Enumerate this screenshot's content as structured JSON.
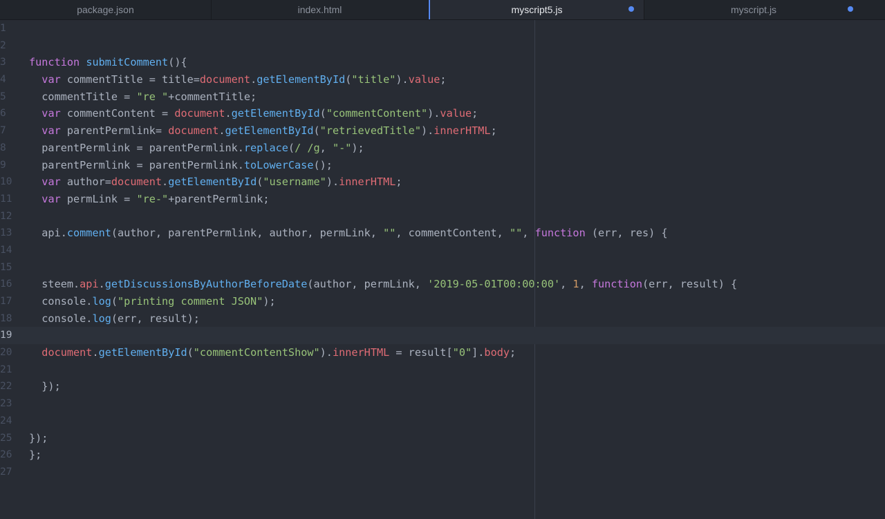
{
  "tabs": [
    {
      "label": "package.json",
      "active": false,
      "modified": false
    },
    {
      "label": "index.html",
      "active": false,
      "modified": false
    },
    {
      "label": "myscript5.js",
      "active": true,
      "modified": true
    },
    {
      "label": "myscript.js",
      "active": false,
      "modified": true
    }
  ],
  "editor": {
    "cursor_line": 19,
    "lines": [
      {
        "n": "1",
        "t": []
      },
      {
        "n": "2",
        "t": []
      },
      {
        "n": "3",
        "t": [
          [
            "kw",
            "function"
          ],
          [
            "pl",
            " "
          ],
          [
            "fn",
            "submitComment"
          ],
          [
            "pl",
            "(){"
          ]
        ]
      },
      {
        "n": "4",
        "t": [
          [
            "pl",
            "  "
          ],
          [
            "kw",
            "var"
          ],
          [
            "pl",
            " commentTitle = title="
          ],
          [
            "prop",
            "document"
          ],
          [
            "pl",
            "."
          ],
          [
            "fn",
            "getElementById"
          ],
          [
            "pl",
            "("
          ],
          [
            "str",
            "\"title\""
          ],
          [
            "pl",
            ")."
          ],
          [
            "prop",
            "value"
          ],
          [
            "pl",
            ";"
          ]
        ]
      },
      {
        "n": "5",
        "t": [
          [
            "pl",
            "  commentTitle = "
          ],
          [
            "str",
            "\"re \""
          ],
          [
            "pl",
            "+commentTitle;"
          ]
        ]
      },
      {
        "n": "6",
        "t": [
          [
            "pl",
            "  "
          ],
          [
            "kw",
            "var"
          ],
          [
            "pl",
            " commentContent = "
          ],
          [
            "prop",
            "document"
          ],
          [
            "pl",
            "."
          ],
          [
            "fn",
            "getElementById"
          ],
          [
            "pl",
            "("
          ],
          [
            "str",
            "\"commentContent\""
          ],
          [
            "pl",
            ")."
          ],
          [
            "prop",
            "value"
          ],
          [
            "pl",
            ";"
          ]
        ]
      },
      {
        "n": "7",
        "t": [
          [
            "pl",
            "  "
          ],
          [
            "kw",
            "var"
          ],
          [
            "pl",
            " parentPermlink= "
          ],
          [
            "prop",
            "document"
          ],
          [
            "pl",
            "."
          ],
          [
            "fn",
            "getElementById"
          ],
          [
            "pl",
            "("
          ],
          [
            "str",
            "\"retrievedTitle\""
          ],
          [
            "pl",
            ")."
          ],
          [
            "prop",
            "innerHTML"
          ],
          [
            "pl",
            ";"
          ]
        ]
      },
      {
        "n": "8",
        "t": [
          [
            "pl",
            "  parentPermlink = parentPermlink."
          ],
          [
            "fn",
            "replace"
          ],
          [
            "pl",
            "("
          ],
          [
            "str",
            "/ /g"
          ],
          [
            "pl",
            ", "
          ],
          [
            "str",
            "\"-\""
          ],
          [
            "pl",
            ");"
          ]
        ]
      },
      {
        "n": "9",
        "t": [
          [
            "pl",
            "  parentPermlink = parentPermlink."
          ],
          [
            "fn",
            "toLowerCase"
          ],
          [
            "pl",
            "();"
          ]
        ]
      },
      {
        "n": "10",
        "t": [
          [
            "pl",
            "  "
          ],
          [
            "kw",
            "var"
          ],
          [
            "pl",
            " author="
          ],
          [
            "prop",
            "document"
          ],
          [
            "pl",
            "."
          ],
          [
            "fn",
            "getElementById"
          ],
          [
            "pl",
            "("
          ],
          [
            "str",
            "\"username\""
          ],
          [
            "pl",
            ")."
          ],
          [
            "prop",
            "innerHTML"
          ],
          [
            "pl",
            ";"
          ]
        ]
      },
      {
        "n": "11",
        "t": [
          [
            "pl",
            "  "
          ],
          [
            "kw",
            "var"
          ],
          [
            "pl",
            " permLink = "
          ],
          [
            "str",
            "\"re-\""
          ],
          [
            "pl",
            "+parentPermlink;"
          ]
        ]
      },
      {
        "n": "12",
        "t": []
      },
      {
        "n": "13",
        "t": [
          [
            "pl",
            "  api."
          ],
          [
            "fn",
            "comment"
          ],
          [
            "pl",
            "(author, parentPermlink, author, permLink, "
          ],
          [
            "str",
            "\"\""
          ],
          [
            "pl",
            ", commentContent, "
          ],
          [
            "str",
            "\"\""
          ],
          [
            "pl",
            ", "
          ],
          [
            "kw",
            "function"
          ],
          [
            "pl",
            " (err, res) {"
          ]
        ]
      },
      {
        "n": "14",
        "t": []
      },
      {
        "n": "15",
        "t": []
      },
      {
        "n": "16",
        "t": [
          [
            "pl",
            "  steem."
          ],
          [
            "prop",
            "api"
          ],
          [
            "pl",
            "."
          ],
          [
            "fn",
            "getDiscussionsByAuthorBeforeDate"
          ],
          [
            "pl",
            "(author, permLink, "
          ],
          [
            "str",
            "'2019-05-01T00:00:00'"
          ],
          [
            "pl",
            ", "
          ],
          [
            "num",
            "1"
          ],
          [
            "pl",
            ", "
          ],
          [
            "kw",
            "function"
          ],
          [
            "pl",
            "(err, result) {"
          ]
        ]
      },
      {
        "n": "17",
        "t": [
          [
            "pl",
            "  console."
          ],
          [
            "fn",
            "log"
          ],
          [
            "pl",
            "("
          ],
          [
            "str",
            "\"printing comment JSON\""
          ],
          [
            "pl",
            ");"
          ]
        ]
      },
      {
        "n": "18",
        "t": [
          [
            "pl",
            "  console."
          ],
          [
            "fn",
            "log"
          ],
          [
            "pl",
            "(err, result);"
          ]
        ]
      },
      {
        "n": "19",
        "t": []
      },
      {
        "n": "20",
        "t": [
          [
            "pl",
            "  "
          ],
          [
            "prop",
            "document"
          ],
          [
            "pl",
            "."
          ],
          [
            "fn",
            "getElementById"
          ],
          [
            "pl",
            "("
          ],
          [
            "str",
            "\"commentContentShow\""
          ],
          [
            "pl",
            ")."
          ],
          [
            "prop",
            "innerHTML"
          ],
          [
            "pl",
            " = result["
          ],
          [
            "str",
            "\"0\""
          ],
          [
            "pl",
            "]."
          ],
          [
            "prop",
            "body"
          ],
          [
            "pl",
            ";"
          ]
        ]
      },
      {
        "n": "21",
        "t": []
      },
      {
        "n": "22",
        "t": [
          [
            "pl",
            "  });"
          ]
        ]
      },
      {
        "n": "23",
        "t": []
      },
      {
        "n": "24",
        "t": []
      },
      {
        "n": "25",
        "t": [
          [
            "pl",
            "});"
          ]
        ]
      },
      {
        "n": "26",
        "t": [
          [
            "pl",
            "};"
          ]
        ]
      },
      {
        "n": "27",
        "t": []
      }
    ]
  }
}
